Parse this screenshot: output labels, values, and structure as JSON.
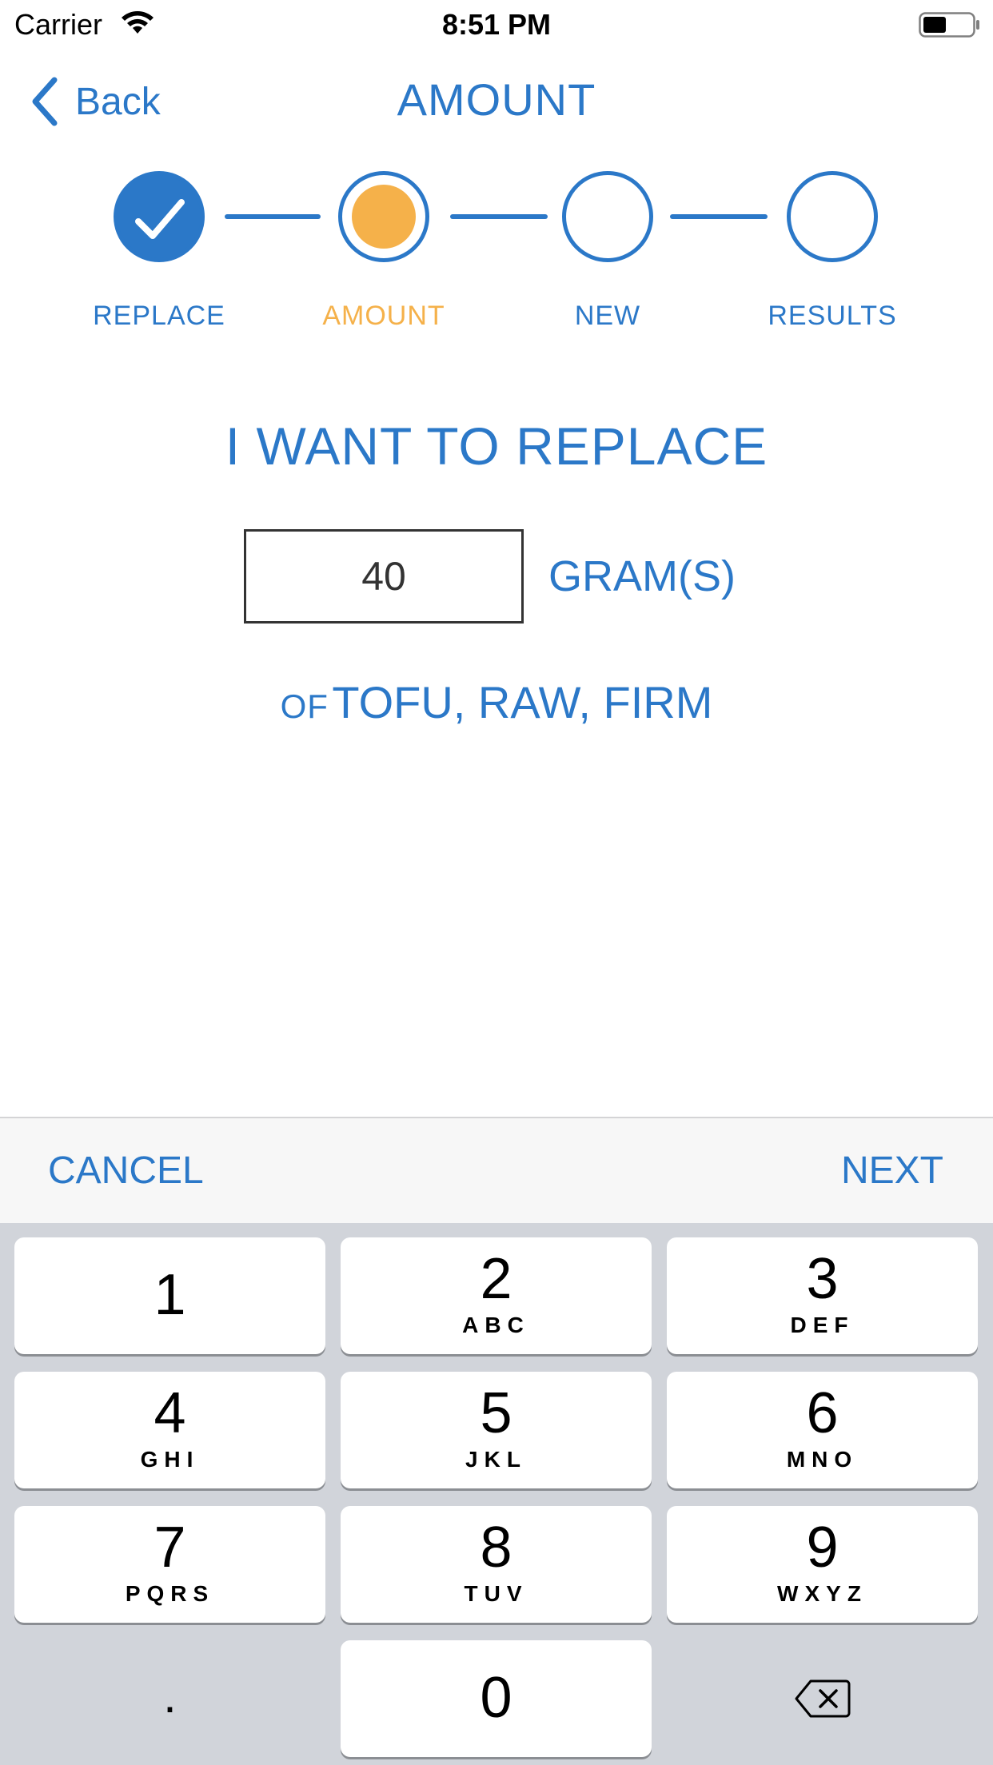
{
  "status_bar": {
    "carrier": "Carrier",
    "time": "8:51 PM",
    "wifi_icon": "wifi-icon",
    "battery_icon": "battery-icon"
  },
  "nav": {
    "back_label": "Back",
    "title": "AMOUNT"
  },
  "stepper": {
    "steps": [
      {
        "label": "REPLACE",
        "state": "done"
      },
      {
        "label": "AMOUNT",
        "state": "active"
      },
      {
        "label": "NEW",
        "state": "pending"
      },
      {
        "label": "RESULTS",
        "state": "pending"
      }
    ]
  },
  "content": {
    "heading": "I WANT TO REPLACE",
    "amount_value": "40",
    "unit": "GRAM(S)",
    "of_label": "OF",
    "food_name": "TOFU, RAW, FIRM"
  },
  "accessory": {
    "cancel_label": "CANCEL",
    "next_label": "NEXT"
  },
  "keypad": {
    "keys": [
      {
        "digit": "1",
        "letters": ""
      },
      {
        "digit": "2",
        "letters": "ABC"
      },
      {
        "digit": "3",
        "letters": "DEF"
      },
      {
        "digit": "4",
        "letters": "GHI"
      },
      {
        "digit": "5",
        "letters": "JKL"
      },
      {
        "digit": "6",
        "letters": "MNO"
      },
      {
        "digit": "7",
        "letters": "PQRS"
      },
      {
        "digit": "8",
        "letters": "TUV"
      },
      {
        "digit": "9",
        "letters": "WXYZ"
      },
      {
        "digit": "0",
        "letters": ""
      }
    ],
    "dot_label": ".",
    "backspace_icon": "backspace-icon"
  },
  "colors": {
    "accent_blue": "#2b78c8",
    "active_orange": "#f5b14a",
    "keypad_bg": "#d1d4da"
  }
}
